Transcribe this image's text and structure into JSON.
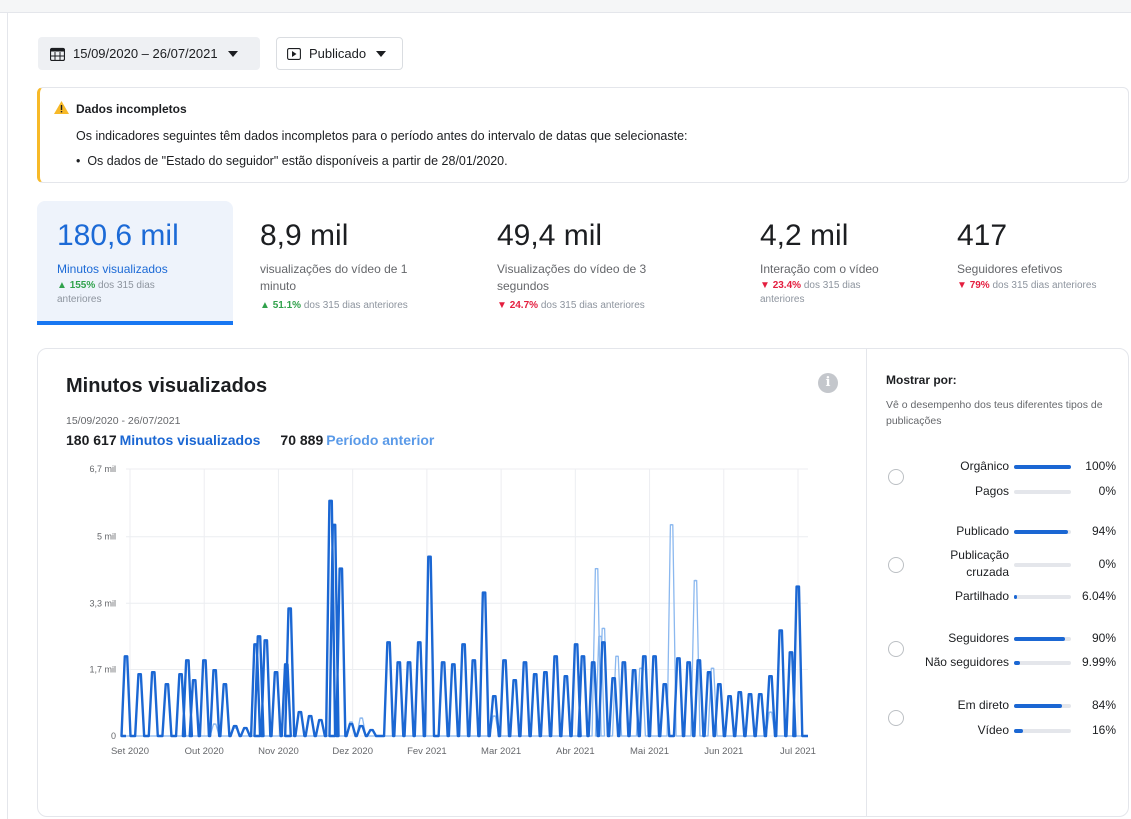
{
  "toolbar": {
    "date_range": "15/09/2020 – 26/07/2021",
    "content_filter": "Publicado"
  },
  "alert": {
    "title": "Dados incompletos",
    "body": "Os indicadores seguintes têm dados incompletos para o período antes do intervalo de datas que selecionaste:",
    "bullet": "Os dados de \"Estado do seguidor\" estão disponíveis a partir de 28/01/2020."
  },
  "metrics": [
    {
      "value": "180,6 mil",
      "label_lines": [
        "Minutos visualizados"
      ],
      "delta": "155%",
      "direction": "up",
      "suffix_lines": [
        "dos 315 dias",
        "anteriores"
      ],
      "active": true
    },
    {
      "value": "8,9 mil",
      "label_lines": [
        "visualizações do vídeo de 1",
        "minuto"
      ],
      "delta": "51.1%",
      "direction": "up",
      "suffix_lines": [
        "dos 315 dias anteriores"
      ],
      "active": false
    },
    {
      "value": "49,4 mil",
      "label_lines": [
        "Visualizações do vídeo de 3",
        "segundos"
      ],
      "delta": "24.7%",
      "direction": "down",
      "suffix_lines": [
        "dos 315 dias anteriores"
      ],
      "active": false
    },
    {
      "value": "4,2 mil",
      "label_lines": [
        "Interação com o vídeo"
      ],
      "delta": "23.4%",
      "direction": "down",
      "suffix_lines": [
        "dos 315 dias",
        "anteriores"
      ],
      "active": false
    },
    {
      "value": "417",
      "label_lines": [
        "Seguidores efetivos"
      ],
      "delta": "79%",
      "direction": "down",
      "suffix_lines": [
        "dos 315 dias anteriores"
      ],
      "active": false
    }
  ],
  "card": {
    "title": "Minutos visualizados",
    "range": "15/09/2020 - 26/07/2021",
    "total": "180 617",
    "total_label": "Minutos visualizados",
    "prev_total": "70 889",
    "prev_label": "Período anterior"
  },
  "sidebar": {
    "title": "Mostrar por:",
    "description": "Vê o desempenho dos teus diferentes tipos de publicações",
    "groups": [
      {
        "rows": [
          {
            "label": "Orgânico",
            "pct": "100%",
            "fraction": 1.0
          },
          {
            "label": "Pagos",
            "pct": "0%",
            "fraction": 0.0
          }
        ]
      },
      {
        "rows": [
          {
            "label": "Publicado",
            "pct": "94%",
            "fraction": 0.94
          },
          {
            "label": "Publicação cruzada",
            "pct": "0%",
            "fraction": 0.0
          },
          {
            "label": "Partilhado",
            "pct": "6.04%",
            "fraction": 0.0604
          }
        ]
      },
      {
        "rows": [
          {
            "label": "Seguidores",
            "pct": "90%",
            "fraction": 0.9
          },
          {
            "label": "Não seguidores",
            "pct": "9.99%",
            "fraction": 0.0999
          }
        ]
      },
      {
        "rows": [
          {
            "label": "Em direto",
            "pct": "84%",
            "fraction": 0.84
          },
          {
            "label": "Vídeo",
            "pct": "16%",
            "fraction": 0.16
          }
        ]
      }
    ]
  },
  "colors": {
    "primary": "#1b67d3",
    "previous": "#8bb8ef",
    "up": "#31a24c",
    "down": "#e41e3f",
    "warning": "#f7b928"
  },
  "chart_data": {
    "type": "line",
    "title": "Minutos visualizados",
    "y_ticks": [
      "0",
      "1,7 mil",
      "3,3 mil",
      "5 mil",
      "6,7 mil"
    ],
    "y_tick_values": [
      0,
      1670,
      3330,
      5000,
      6700
    ],
    "ylim": [
      0,
      6700
    ],
    "x_ticks": [
      "Set 2020",
      "Out 2020",
      "Nov 2020",
      "Dez 2020",
      "Fev 2021",
      "Mar 2021",
      "Abr 2021",
      "Mai 2021",
      "Jun 2021",
      "Jul 2021"
    ],
    "grid": true,
    "series": [
      {
        "name": "Minutos visualizados",
        "color": "#1b67d3",
        "spikes": [
          [
            0.0,
            2000
          ],
          [
            0.02,
            1550
          ],
          [
            0.04,
            1600
          ],
          [
            0.06,
            1300
          ],
          [
            0.08,
            1550
          ],
          [
            0.09,
            1900
          ],
          [
            0.1,
            1400
          ],
          [
            0.115,
            1900
          ],
          [
            0.13,
            1650
          ],
          [
            0.145,
            1300
          ],
          [
            0.16,
            250
          ],
          [
            0.175,
            200
          ],
          [
            0.19,
            2300
          ],
          [
            0.195,
            2500
          ],
          [
            0.205,
            2400
          ],
          [
            0.22,
            1600
          ],
          [
            0.235,
            1800
          ],
          [
            0.24,
            3200
          ],
          [
            0.255,
            600
          ],
          [
            0.27,
            500
          ],
          [
            0.285,
            400
          ],
          [
            0.3,
            5900
          ],
          [
            0.305,
            5300
          ],
          [
            0.315,
            4200
          ],
          [
            0.33,
            300
          ],
          [
            0.345,
            250
          ],
          [
            0.36,
            150
          ],
          [
            0.385,
            2350
          ],
          [
            0.4,
            1850
          ],
          [
            0.415,
            1850
          ],
          [
            0.43,
            2350
          ],
          [
            0.445,
            4500
          ],
          [
            0.465,
            1850
          ],
          [
            0.48,
            1800
          ],
          [
            0.495,
            2300
          ],
          [
            0.51,
            1900
          ],
          [
            0.525,
            3600
          ],
          [
            0.54,
            1000
          ],
          [
            0.555,
            1900
          ],
          [
            0.57,
            1400
          ],
          [
            0.585,
            1850
          ],
          [
            0.6,
            1550
          ],
          [
            0.615,
            1600
          ],
          [
            0.63,
            2000
          ],
          [
            0.645,
            1500
          ],
          [
            0.66,
            2300
          ],
          [
            0.67,
            2000
          ],
          [
            0.685,
            1850
          ],
          [
            0.7,
            2350
          ],
          [
            0.715,
            1450
          ],
          [
            0.73,
            1850
          ],
          [
            0.745,
            1650
          ],
          [
            0.76,
            2000
          ],
          [
            0.775,
            2000
          ],
          [
            0.79,
            1300
          ],
          [
            0.81,
            1950
          ],
          [
            0.825,
            1850
          ],
          [
            0.84,
            1900
          ],
          [
            0.855,
            1600
          ],
          [
            0.87,
            1300
          ],
          [
            0.885,
            1000
          ],
          [
            0.9,
            1100
          ],
          [
            0.915,
            1050
          ],
          [
            0.93,
            1050
          ],
          [
            0.945,
            1500
          ],
          [
            0.96,
            2650
          ],
          [
            0.975,
            2100
          ],
          [
            0.985,
            3750
          ]
        ]
      },
      {
        "name": "Período anterior",
        "color": "#8bb8ef",
        "spikes": [
          [
            0.13,
            300
          ],
          [
            0.16,
            200
          ],
          [
            0.33,
            350
          ],
          [
            0.345,
            450
          ],
          [
            0.54,
            500
          ],
          [
            0.69,
            4200
          ],
          [
            0.695,
            2500
          ],
          [
            0.7,
            2700
          ],
          [
            0.72,
            2000
          ],
          [
            0.755,
            1700
          ],
          [
            0.8,
            5300
          ],
          [
            0.835,
            3900
          ],
          [
            0.86,
            1700
          ],
          [
            0.945,
            600
          ]
        ]
      }
    ]
  }
}
